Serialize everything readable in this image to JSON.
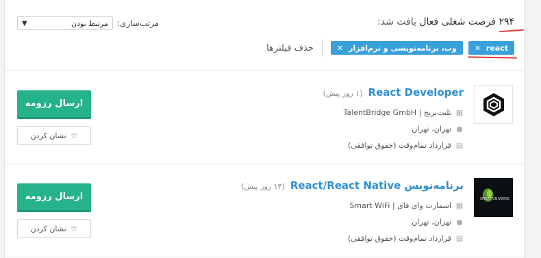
{
  "header": {
    "count": "۲۹۴",
    "summary_strong": "فرصت شغلی فعال",
    "summary_light": "یافت شد:",
    "sort_label": "مرتب‌سازی:",
    "sort_value": "مرتبط بودن",
    "filters": [
      {
        "label": "react"
      },
      {
        "label": "وب، برنامه‌نویسی و نرم‌افزار"
      }
    ],
    "clear_filters": "حذف فیلترها",
    "annotation_color": "#e53935"
  },
  "jobs": [
    {
      "title": "React Developer",
      "posted": "(۱ روز پیش)",
      "company": "تلنت‌بریج | TalentBridge GmbH",
      "location": "تهران، تهران",
      "contract": "قرارداد تمام‌وقت (حقوق توافقی)",
      "logo_icon": "hexagon-logo-icon",
      "apply_label": "ارسال رزومه",
      "bookmark_label": "نشان کردن"
    },
    {
      "title": "برنامه‌نویس React/React Native",
      "posted": "(۱۴ روز پیش)",
      "company": "اسمارت وای فای | Smart WiFi",
      "location": "تهران، تهران",
      "contract": "قرارداد تمام‌وقت (حقوق توافقی)",
      "logo_icon": "smart-universe-logo-icon",
      "logo_text": "SMART UNIVERSE",
      "apply_label": "ارسال رزومه",
      "bookmark_label": "نشان کردن"
    }
  ],
  "colors": {
    "accent": "#3aa0da",
    "title_link": "#2f8fd1",
    "apply_button": "#26b28a"
  }
}
